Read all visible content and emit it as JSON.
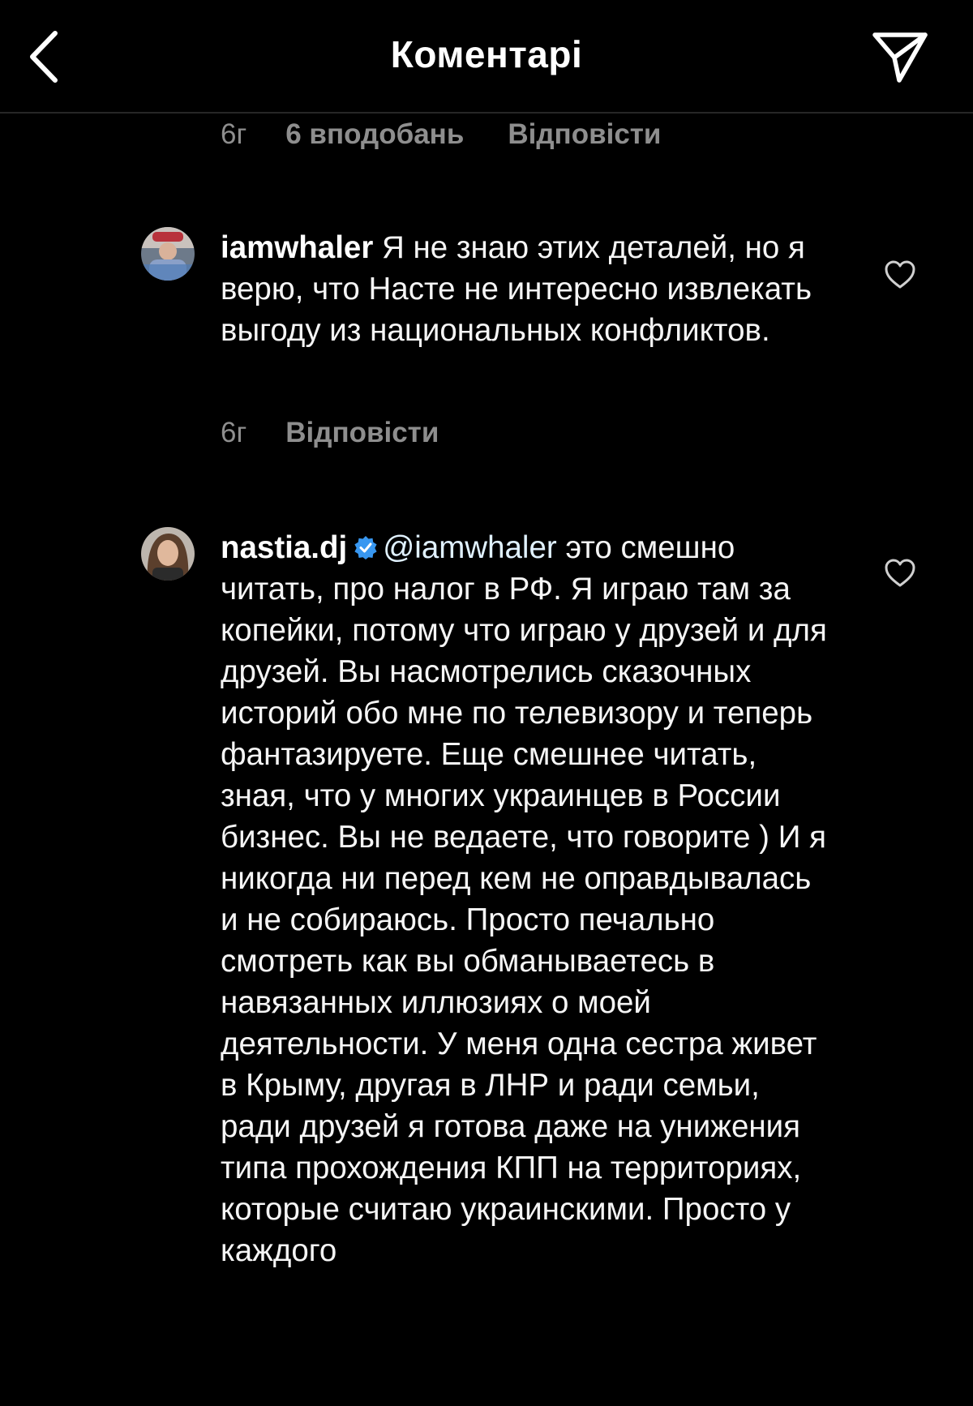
{
  "header": {
    "title": "Коментарі"
  },
  "top_meta": {
    "time": "6г",
    "likes": "6 вподобань",
    "reply": "Відповісти"
  },
  "comments": [
    {
      "username": "iamwhaler",
      "text": "Я не знаю этих деталей, но я верю, что Насте не интересно извлекать выгоду из национальных конфликтов.",
      "time": "6г",
      "reply": "Відповісти",
      "like_icon": "heart-outline-icon"
    },
    {
      "username": "nastia.dj",
      "verified": true,
      "mention": "@iamwhaler",
      "text": "это смешно читать, про налог в РФ. Я играю там за копейки, потому что играю у друзей и для друзей. Вы насмотрелись сказочных историй обо мне по телевизору и теперь фантазируете. Еще смешнее читать, зная, что у многих украинцев в России бизнес. Вы не ведаете, что говорите ) И я никогда ни перед кем не оправдывалась и не собираюсь. Просто печально смотреть как вы обманываетесь в навязанных иллюзиях о моей деятельности. У меня одна сестра живет в Крыму, другая в ЛНР и ради семьи, ради друзей я готова даже на унижения типа прохождения КПП на территориях, которые считаю украинскими. Просто у каждого",
      "like_icon": "heart-outline-icon"
    }
  ],
  "colors": {
    "background": "#000000",
    "text": "#f5f5f5",
    "secondary_text": "#8e8e8e",
    "verified_badge": "#3897f0",
    "divider": "#262626"
  },
  "icons": [
    "chevron-left-icon",
    "send-icon",
    "heart-outline-icon",
    "verified-badge-icon"
  ]
}
